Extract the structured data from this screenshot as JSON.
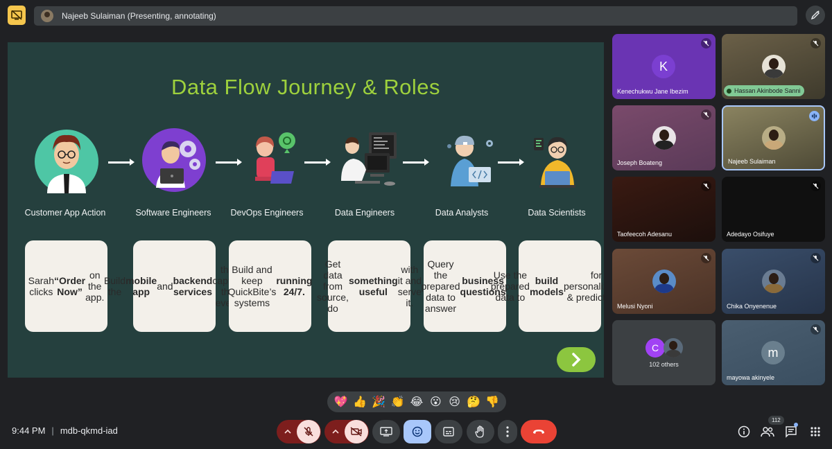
{
  "presentation_bar": {
    "presenter_text": "Najeeb Sulaiman (Presenting, annotating)"
  },
  "slide": {
    "title": "Data Flow Journey & Roles",
    "roles": [
      {
        "label": "Customer App Action",
        "card_html": "Sarah clicks <b>“Order Now”</b> on the app."
      },
      {
        "label": "Software Engineers",
        "card_html": "Build the <b>mobile app</b> and <b>backend services</b> that capture this event."
      },
      {
        "label": "DevOps Engineers",
        "card_html": "Build and keep QuickBite’s systems <b>running 24/7.</b>"
      },
      {
        "label": "Data Engineers",
        "card_html": "Get data from source, do <b>something useful</b> with it and serve it."
      },
      {
        "label": "Data Analysts",
        "card_html": "Query the prepared data to answer <b>business questions</b>."
      },
      {
        "label": "Data Scientists",
        "card_html": "Use the prepared data to <b>build models</b> for personalization &amp; predictions."
      }
    ]
  },
  "participants": [
    {
      "name": "Kenechukwu Jane Ibezim",
      "initial": "K",
      "avatar_color": "#7b3fd1"
    },
    {
      "name": "Hassan Akinbode Sanni"
    },
    {
      "name": "Joseph Boateng"
    },
    {
      "name": "Najeeb Sulaiman"
    },
    {
      "name": "Taofeecoh Adesanu"
    },
    {
      "name": "Adedayo Osifuye"
    },
    {
      "name": "Melusi Nyoni"
    },
    {
      "name": "Chika Onyenenue"
    },
    {
      "name": "102 others",
      "initial": "C",
      "avatar_color": "#a142f4"
    },
    {
      "name": "mayowa akinyele",
      "initial": "m",
      "avatar_color": "#6a7f8e"
    }
  ],
  "reactions": [
    "💖",
    "👍",
    "🎉",
    "👏",
    "😂",
    "😮",
    "😢",
    "🤔",
    "👎"
  ],
  "bottom_bar": {
    "time": "9:44 PM",
    "meeting_code": "mdb-qkmd-iad",
    "people_count": "112"
  },
  "colors": {
    "accent_yellow": "#f5c64d",
    "slide_bg": "#25403e",
    "title_green": "#9ed13d",
    "end_call_red": "#ea4335"
  },
  "icons": {
    "stop_presenting": "stop-presenting-icon",
    "annotate": "pen-icon",
    "mic": "mic-off-icon",
    "camera": "camera-off-icon",
    "present": "present-screen-icon",
    "emoji": "emoji-icon",
    "captions": "captions-icon",
    "raise_hand": "raise-hand-icon",
    "more": "more-vert-icon",
    "end_call": "end-call-icon",
    "info": "info-icon",
    "people": "people-icon",
    "chat": "chat-icon",
    "activities": "apps-grid-icon"
  }
}
